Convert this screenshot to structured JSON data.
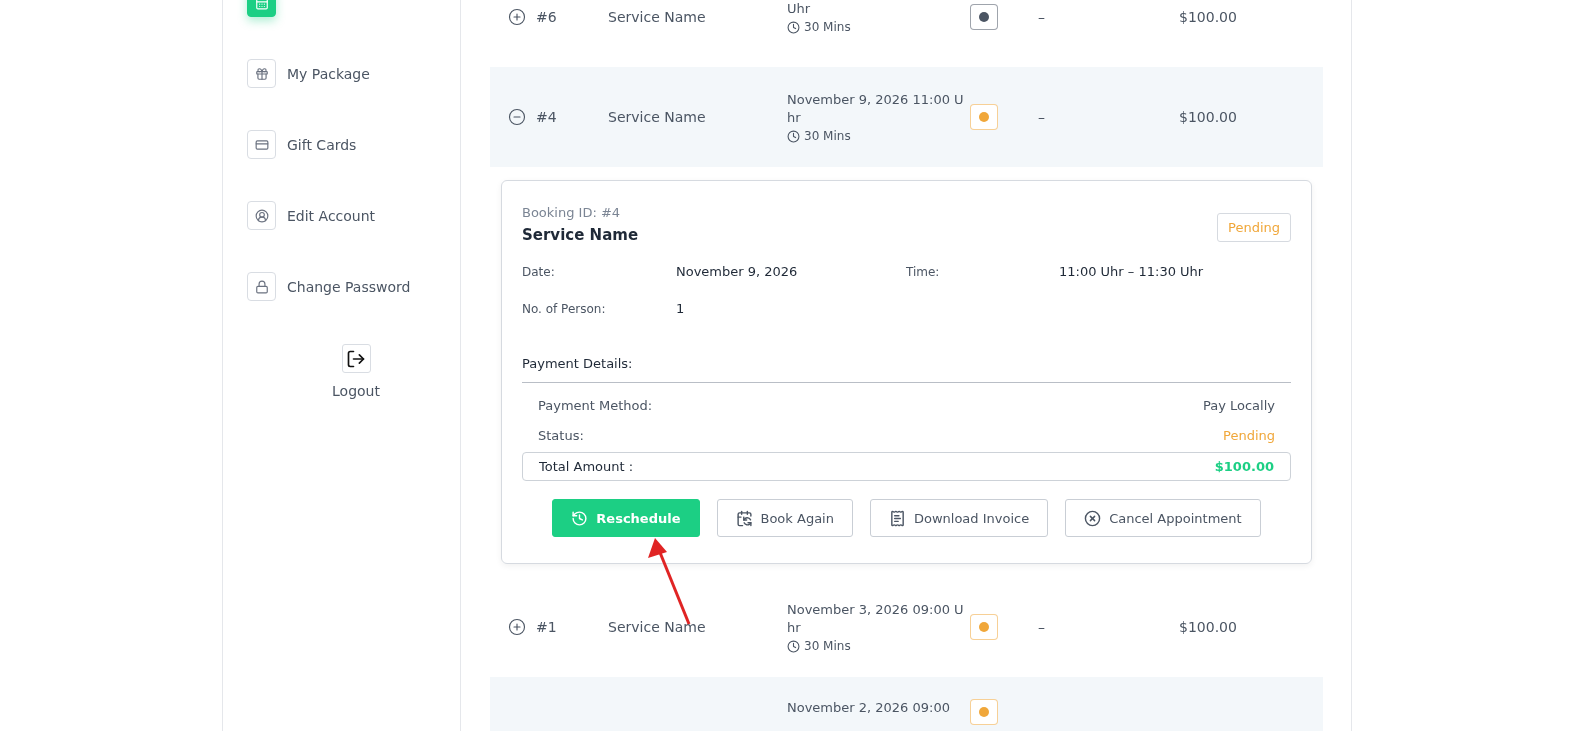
{
  "sidebar": {
    "items": [
      {
        "kind": "calendar",
        "selected": true
      },
      {
        "kind": "gift",
        "label": "My Package",
        "selected": false
      },
      {
        "kind": "card",
        "label": "Gift Cards",
        "selected": false
      },
      {
        "kind": "user",
        "label": "Edit Account",
        "selected": false
      },
      {
        "kind": "lock",
        "label": "Change Password",
        "selected": false
      }
    ],
    "logout": "Logout"
  },
  "appointments": [
    {
      "id": "#6",
      "service": "Service Name",
      "date": "Uhr",
      "duration": "30 Mins",
      "color": "#4b5563",
      "staff": "–",
      "price": "$100.00",
      "expanded": false
    },
    {
      "id": "#4",
      "service": "Service Name",
      "date": "November 9, 2026 11:00 Uhr",
      "duration": "30 Mins",
      "color": "#f0a73a",
      "staff": "–",
      "price": "$100.00",
      "expanded": true,
      "details": {
        "booking_id": "Booking ID: #4",
        "title": "Service Name",
        "badge": "Pending",
        "fields": [
          {
            "label": "Date:",
            "value": "November 9, 2026"
          },
          {
            "label": "Time:",
            "value": "11:00 Uhr – 11:30 Uhr"
          },
          {
            "label": "No. of Person:",
            "value": "1"
          }
        ],
        "payment_heading": "Payment Details:",
        "payment_rows": [
          {
            "kind": "plain",
            "label": "Payment Method:",
            "value": "Pay Locally"
          },
          {
            "kind": "status",
            "label": "Status:",
            "value": "Pending"
          }
        ],
        "total": {
          "label": "Total Amount :",
          "value": "$100.00"
        },
        "buttons": [
          {
            "kind": "reschedule",
            "label": "Reschedule"
          },
          {
            "kind": "book",
            "label": "Book Again"
          },
          {
            "kind": "invoice",
            "label": "Download Invoice"
          },
          {
            "kind": "cancel",
            "label": "Cancel Appointment"
          }
        ]
      }
    },
    {
      "id": "#1",
      "service": "Service Name",
      "date": "November 3, 2026 09:00 Uhr",
      "duration": "30 Mins",
      "color": "#f0a73a",
      "staff": "–",
      "price": "$100.00",
      "expanded": false
    },
    {
      "date": "November 2, 2026 09:00",
      "color": "#f0a73a"
    }
  ]
}
